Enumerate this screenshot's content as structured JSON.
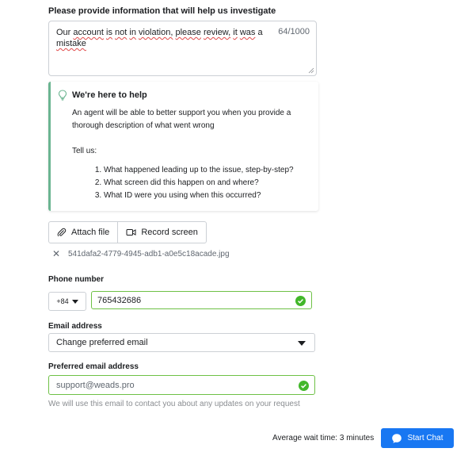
{
  "description_section": {
    "title": "Please provide information that will help us investigate",
    "text_part1": "Our",
    "text_part2": "account",
    "text_part3": "is",
    "text_part4": "not",
    "text_part5": "in",
    "text_part6": "violation,",
    "text_part7": "please",
    "text_part8": "review,",
    "text_part9": "it",
    "text_part10": "was",
    "text_part11": "a",
    "text_part12": "mistake",
    "char_count": "64/1000"
  },
  "help_box": {
    "title": "We're here to help",
    "intro": "An agent will be able to better support you when you provide a thorough description of what went wrong",
    "tell_us": "Tell us:",
    "items": [
      "What happened leading up to the issue, step-by-step?",
      "What screen did this happen on and where?",
      "What ID were you using when this occurred?"
    ],
    "accent_color": "#6bb591"
  },
  "attachments": {
    "attach_label": "Attach file",
    "record_label": "Record screen",
    "file_name": "541dafa2-4779-4945-adb1-a0e5c18acade.jpg"
  },
  "phone": {
    "label": "Phone number",
    "country_code": "+84",
    "value": "765432686"
  },
  "email": {
    "label": "Email address",
    "selected": "Change preferred email"
  },
  "preferred_email": {
    "label": "Preferred email address",
    "value": "support@weads.pro",
    "helper": "We will use this email to contact you about any updates on your request"
  },
  "footer": {
    "wait_text": "Average wait time: 3 minutes",
    "chat_label": "Start Chat",
    "button_color": "#1877f2"
  },
  "icons": {
    "bulb": "lightbulb-icon",
    "paperclip": "paperclip-icon",
    "record": "video-camera-icon",
    "remove": "close-icon",
    "check": "check-circle-icon",
    "chat": "chat-bubble-icon"
  }
}
